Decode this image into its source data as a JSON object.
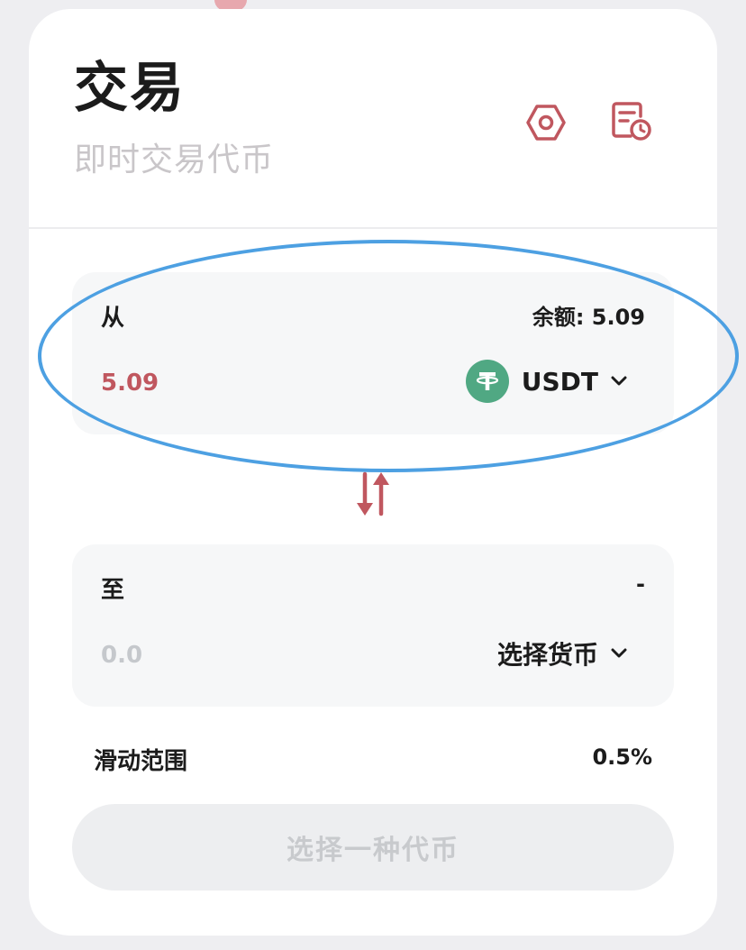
{
  "header": {
    "title": "交易",
    "subtitle": "即时交易代币",
    "settings_icon": "settings-icon",
    "history_icon": "history-icon"
  },
  "from": {
    "label": "从",
    "balance": "余额: 5.09",
    "amount": "5.09",
    "token": "USDT",
    "token_icon": "tether-icon"
  },
  "swap_icon": "swap-arrows-icon",
  "to": {
    "label": "至",
    "balance": "-",
    "amount": "0.0",
    "token_placeholder": "选择货币"
  },
  "slippage": {
    "label": "滑动范围",
    "value": "0.5%"
  },
  "action_button": {
    "label": "选择一种代币",
    "disabled": true
  },
  "colors": {
    "accent": "#c0575f",
    "tether_green": "#50a883",
    "annotation_blue": "#4da0e2"
  }
}
